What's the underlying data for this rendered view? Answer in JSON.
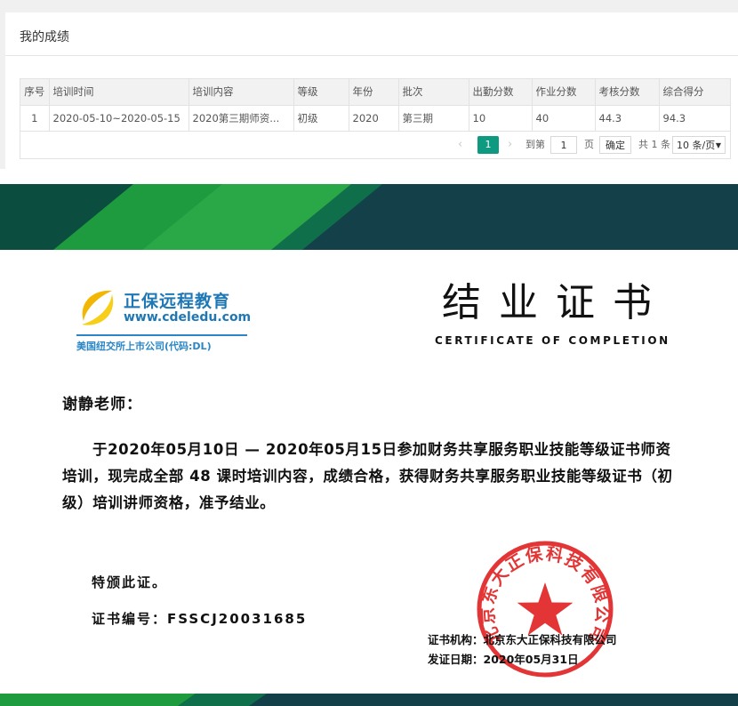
{
  "panel": {
    "title": "我的成绩"
  },
  "table": {
    "headers": [
      "序号",
      "培训时间",
      "培训内容",
      "等级",
      "年份",
      "批次",
      "出勤分数",
      "作业分数",
      "考核分数",
      "综合得分"
    ],
    "rows": [
      [
        "1",
        "2020-05-10~2020-05-15",
        "2020第三期师资...",
        "初级",
        "2020",
        "第三期",
        "10",
        "40",
        "44.3",
        "94.3"
      ]
    ]
  },
  "pager": {
    "prev": "‹",
    "current": "1",
    "next": "›",
    "goto_label": "到第",
    "goto_value": "1",
    "page_label": "页",
    "confirm_label": "确定",
    "total": "共 1 条",
    "page_size": "10 条/页"
  },
  "certificate": {
    "logo_name": "正保远程教育",
    "logo_url": "www.cdeledu.com",
    "logo_sub": "美国纽交所上市公司(代码:DL)",
    "title": "结业证书",
    "subtitle": "CERTIFICATE OF COMPLETION",
    "greeting": "谢静老师：",
    "body": "于2020年05月10日 — 2020年05月15日参加财务共享服务职业技能等级证书师资培训，现完成全部 48 课时培训内容，成绩合格，获得财务共享服务职业技能等级证书（初级）培训讲师资格，准予结业。",
    "special": "特颁此证。",
    "cert_no": "证书编号：FSSCJ20031685",
    "org": "证书机构：北京东大正保科技有限公司",
    "date": "发证日期：2020年05月31日",
    "seal_text": "北京东大正保科技有限公司",
    "colors": {
      "dark": "#0f3c45",
      "green": "#1f9a3c",
      "seal": "#e02020",
      "brand": "#1f78b4"
    }
  }
}
